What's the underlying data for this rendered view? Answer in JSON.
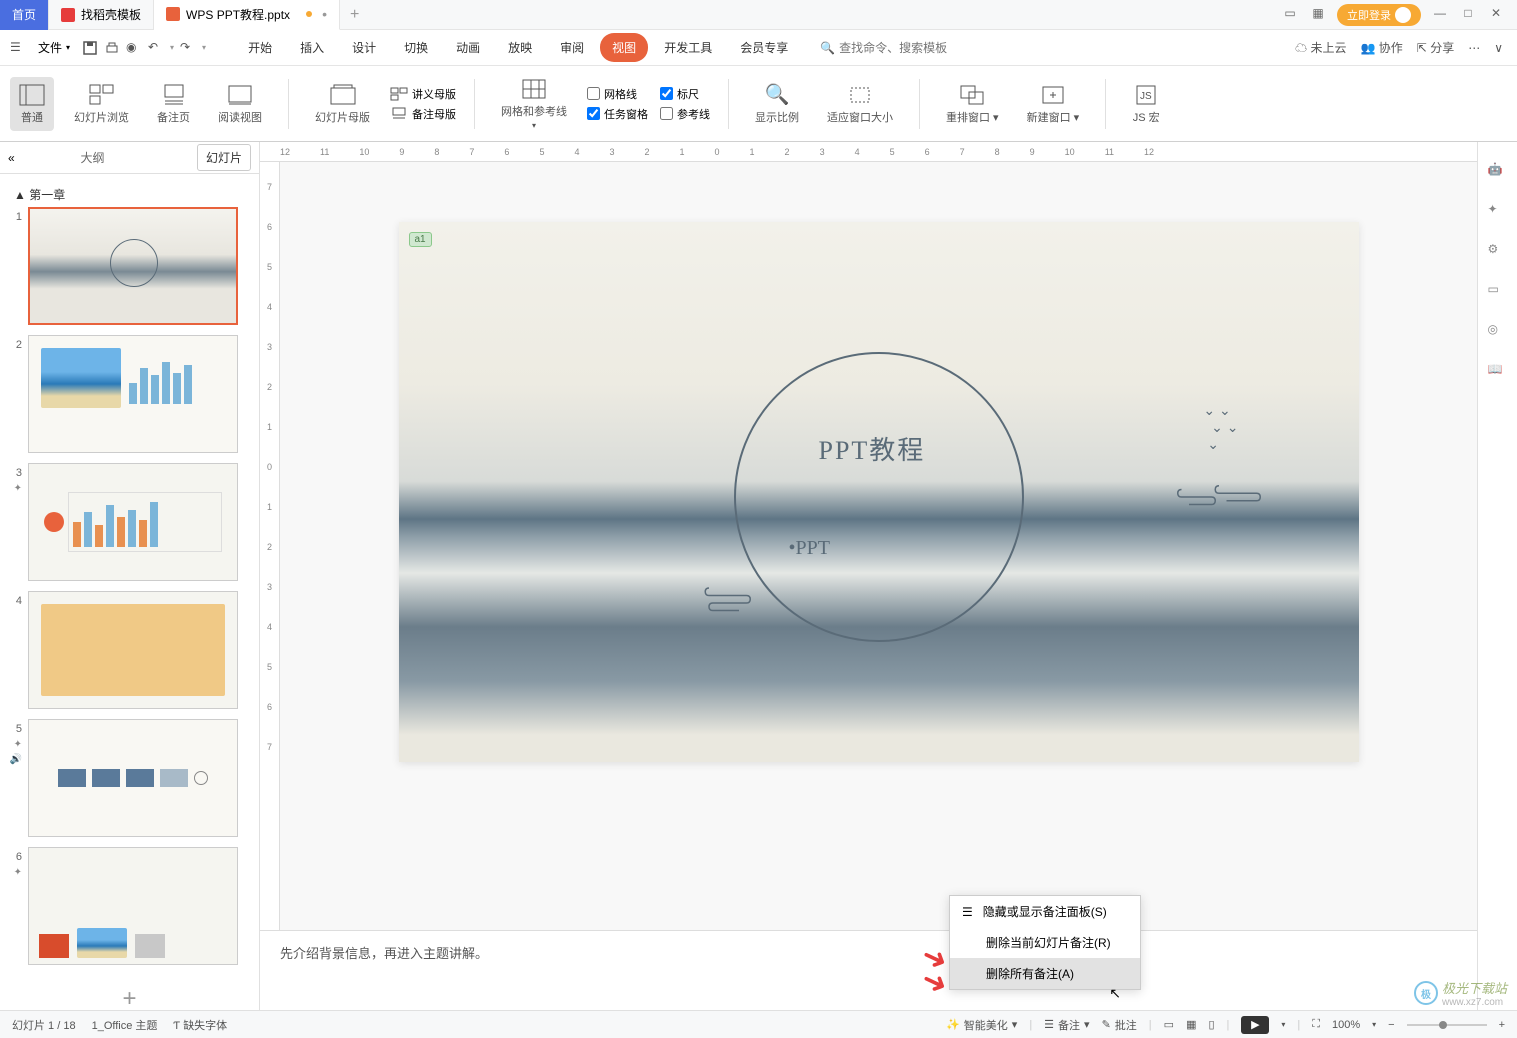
{
  "titlebar": {
    "home": "首页",
    "template": "找稻壳模板",
    "filename": "WPS PPT教程.pptx",
    "login": "立即登录"
  },
  "menubar": {
    "file": "文件",
    "tabs": [
      "开始",
      "插入",
      "设计",
      "切换",
      "动画",
      "放映",
      "审阅",
      "视图",
      "开发工具",
      "会员专享"
    ],
    "active": "视图",
    "search_ph": "查找命令、搜索模板",
    "cloud": "未上云",
    "coop": "协作",
    "share": "分享"
  },
  "ribbon": {
    "normal": "普通",
    "browse": "幻灯片浏览",
    "notes": "备注页",
    "reading": "阅读视图",
    "master": "幻灯片母版",
    "handout": "讲义母版",
    "notes_master": "备注母版",
    "gridline": "网格线",
    "taskpane": "任务窗格",
    "ruler": "标尺",
    "guides": "参考线",
    "grid_ref": "网格和参考线",
    "zoom": "显示比例",
    "fit": "适应窗口大小",
    "arrange": "重排窗口",
    "new_win": "新建窗口",
    "js_macro": "JS 宏"
  },
  "sidebar": {
    "outline": "大纲",
    "slides": "幻灯片",
    "chapter": "第一章"
  },
  "slides": [
    "1",
    "2",
    "3",
    "4",
    "5",
    "6"
  ],
  "stage": {
    "title": "PPT教程",
    "sub": "•PPT",
    "comment": "a1"
  },
  "notes": "先介绍背景信息，再进入主题讲解。",
  "context_menu": {
    "item1": "隐藏或显示备注面板(S)",
    "item2": "删除当前幻灯片备注(R)",
    "item3": "删除所有备注(A)"
  },
  "statusbar": {
    "slide_count": "幻灯片 1 / 18",
    "theme": "1_Office 主题",
    "missing_font": "缺失字体",
    "beautify": "智能美化",
    "notes_btn": "备注",
    "comments_btn": "批注",
    "zoom": "100%"
  },
  "ruler_h": [
    "12",
    "11",
    "10",
    "9",
    "8",
    "7",
    "6",
    "5",
    "4",
    "3",
    "2",
    "1",
    "0",
    "1",
    "2",
    "3",
    "4",
    "5",
    "6",
    "7",
    "8",
    "9",
    "10",
    "11",
    "12"
  ],
  "ruler_v": [
    "7",
    "6",
    "5",
    "4",
    "3",
    "2",
    "1",
    "0",
    "1",
    "2",
    "3",
    "4",
    "5",
    "6",
    "7"
  ],
  "watermark": {
    "text": "极光下载站",
    "url": "www.xz7.com"
  }
}
